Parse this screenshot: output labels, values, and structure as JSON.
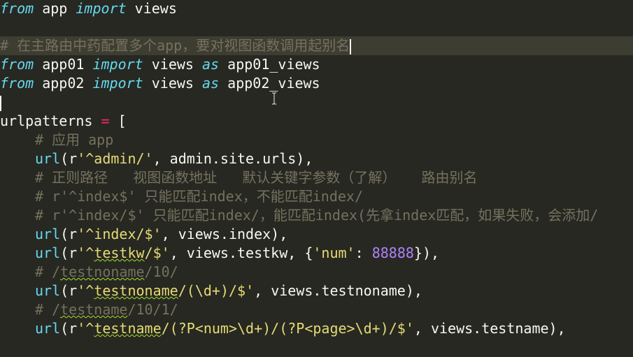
{
  "code": {
    "line1": {
      "kw1": "from",
      "t1": " app ",
      "kw2": "import",
      "t2": " views"
    },
    "line3": {
      "comment": "# 在主路由中药配置多个app，要对视图函数调用起别名"
    },
    "line4": {
      "kw1": "from",
      "t1": " app01 ",
      "kw2": "import",
      "t2": " views ",
      "kw3": "as",
      "t3": " app01_views"
    },
    "line5": {
      "kw1": "from",
      "t1": " app02 ",
      "kw2": "import",
      "t2": " views ",
      "kw3": "as",
      "t3": " app02_views"
    },
    "line7": {
      "t1": "urlpatterns ",
      "op": "=",
      "t2": " ["
    },
    "line8": {
      "comment": "# 应用 app"
    },
    "line9": {
      "fn": "url",
      "p1": "(r",
      "str": "'^admin/'",
      "t": ", admin.site.urls),"
    },
    "line10": {
      "comment": "# 正则路径   视图函数地址   默认关键字参数（了解）   路由别名"
    },
    "line11": {
      "comment": "# r'^index$' 只能匹配index，不能匹配index/"
    },
    "line12": {
      "comment": "# r'^index/$' 只能匹配index/，能匹配index(先拿index匹配，如果失败，会添加/"
    },
    "line13": {
      "fn": "url",
      "p1": "(r",
      "str": "'^index/$'",
      "t": ", views.index),"
    },
    "line14": {
      "fn": "url",
      "p1": "(r",
      "str_a": "'^",
      "str_u": "testkw",
      "str_b": "/$'",
      "t1": ", views.testkw, {",
      "key": "'num'",
      "t2": ": ",
      "num": "88888",
      "t3": "}),"
    },
    "line15": {
      "comment_a": "# /",
      "comment_u": "testnoname",
      "comment_b": "/10/"
    },
    "line16": {
      "fn": "url",
      "p1": "(r",
      "str_a": "'^",
      "str_u": "testnoname",
      "str_b": "/(\\d+)/$'",
      "t": ", views.testnoname),"
    },
    "line17": {
      "comment_a": "# /",
      "comment_u": "testname",
      "comment_b": "/10/1/"
    },
    "line18": {
      "fn": "url",
      "p1": "(r",
      "str_a": "'^",
      "str_u": "testname",
      "str_b": "/(?P<num>\\d+)/(?P<page>\\d+)/$'",
      "t": ", views.testname),"
    }
  }
}
